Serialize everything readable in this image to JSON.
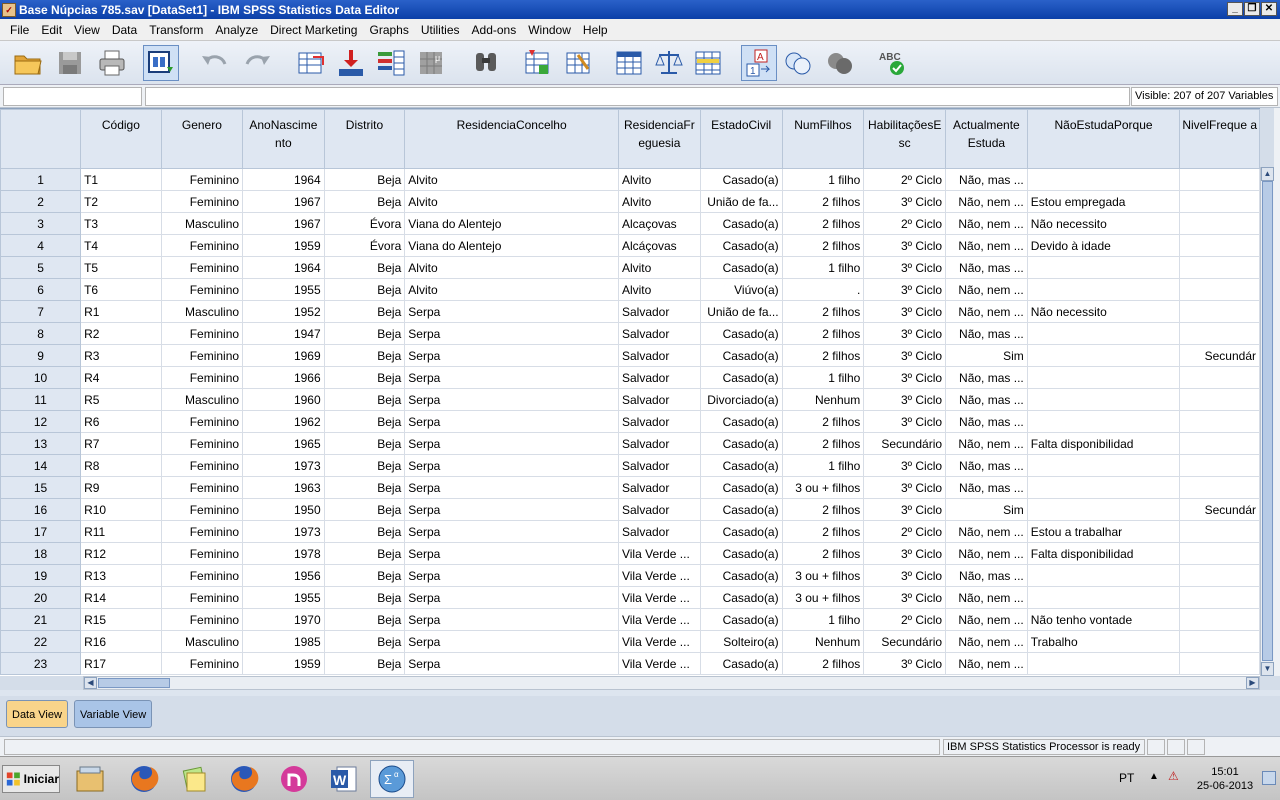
{
  "window": {
    "title": "Base Núpcias 785.sav [DataSet1] - IBM SPSS Statistics Data Editor"
  },
  "menu": [
    "File",
    "Edit",
    "View",
    "Data",
    "Transform",
    "Analyze",
    "Direct Marketing",
    "Graphs",
    "Utilities",
    "Add-ons",
    "Window",
    "Help"
  ],
  "editbar": {
    "cell_ref": "",
    "cell_value": "",
    "visible": "Visible: 207 of 207 Variables"
  },
  "grid": {
    "columns": [
      {
        "label": "Código",
        "align": "l"
      },
      {
        "label": "Genero",
        "align": "r"
      },
      {
        "label": "AnoNascime nto",
        "align": "r"
      },
      {
        "label": "Distrito",
        "align": "r"
      },
      {
        "label": "ResidenciaConcelho",
        "align": "l"
      },
      {
        "label": "ResidenciaFr eguesia",
        "align": "l"
      },
      {
        "label": "EstadoCivil",
        "align": "r"
      },
      {
        "label": "NumFilhos",
        "align": "r"
      },
      {
        "label": "HabilitaçõesE sc",
        "align": "r"
      },
      {
        "label": "Actualmente Estuda",
        "align": "r"
      },
      {
        "label": "NãoEstudaPorque",
        "align": "l"
      },
      {
        "label": "NivelFreque a",
        "align": "r"
      }
    ],
    "rows": [
      {
        "n": "1",
        "cells": [
          "T1",
          "Feminino",
          "1964",
          "Beja",
          "Alvito",
          "Alvito",
          "Casado(a)",
          "1 filho",
          "2º Ciclo",
          "Não, mas ...",
          "",
          ""
        ]
      },
      {
        "n": "2",
        "cells": [
          "T2",
          "Feminino",
          "1967",
          "Beja",
          "Alvito",
          "Alvito",
          "União de fa...",
          "2 filhos",
          "3º Ciclo",
          "Não, nem ...",
          "Estou empregada",
          ""
        ]
      },
      {
        "n": "3",
        "cells": [
          "T3",
          "Masculino",
          "1967",
          "Évora",
          "Viana do Alentejo",
          "Alcaçovas",
          "Casado(a)",
          "2 filhos",
          "2º Ciclo",
          "Não, nem ...",
          "Não necessito",
          ""
        ]
      },
      {
        "n": "4",
        "cells": [
          "T4",
          "Feminino",
          "1959",
          "Évora",
          "Viana do Alentejo",
          "Alcáçovas",
          "Casado(a)",
          "2 filhos",
          "3º Ciclo",
          "Não, nem ...",
          "Devido à idade",
          ""
        ]
      },
      {
        "n": "5",
        "cells": [
          "T5",
          "Feminino",
          "1964",
          "Beja",
          "Alvito",
          "Alvito",
          "Casado(a)",
          "1 filho",
          "3º Ciclo",
          "Não, mas ...",
          "",
          ""
        ]
      },
      {
        "n": "6",
        "cells": [
          "T6",
          "Feminino",
          "1955",
          "Beja",
          "Alvito",
          "Alvito",
          "Viúvo(a)",
          ".",
          "3º Ciclo",
          "Não, nem ...",
          "",
          ""
        ]
      },
      {
        "n": "7",
        "cells": [
          "R1",
          "Masculino",
          "1952",
          "Beja",
          "Serpa",
          "Salvador",
          "União de fa...",
          "2 filhos",
          "3º Ciclo",
          "Não, nem ...",
          "Não necessito",
          ""
        ]
      },
      {
        "n": "8",
        "cells": [
          "R2",
          "Feminino",
          "1947",
          "Beja",
          "Serpa",
          "Salvador",
          "Casado(a)",
          "2 filhos",
          "3º Ciclo",
          "Não, mas ...",
          "",
          ""
        ]
      },
      {
        "n": "9",
        "cells": [
          "R3",
          "Feminino",
          "1969",
          "Beja",
          "Serpa",
          "Salvador",
          "Casado(a)",
          "2 filhos",
          "3º Ciclo",
          "Sim",
          "",
          "Secundár"
        ]
      },
      {
        "n": "10",
        "cells": [
          "R4",
          "Feminino",
          "1966",
          "Beja",
          "Serpa",
          "Salvador",
          "Casado(a)",
          "1 filho",
          "3º Ciclo",
          "Não, mas ...",
          "",
          ""
        ]
      },
      {
        "n": "11",
        "cells": [
          "R5",
          "Masculino",
          "1960",
          "Beja",
          "Serpa",
          "Salvador",
          "Divorciado(a)",
          "Nenhum",
          "3º Ciclo",
          "Não, mas ...",
          "",
          ""
        ]
      },
      {
        "n": "12",
        "cells": [
          "R6",
          "Feminino",
          "1962",
          "Beja",
          "Serpa",
          "Salvador",
          "Casado(a)",
          "2 filhos",
          "3º Ciclo",
          "Não, mas ...",
          "",
          ""
        ]
      },
      {
        "n": "13",
        "cells": [
          "R7",
          "Feminino",
          "1965",
          "Beja",
          "Serpa",
          "Salvador",
          "Casado(a)",
          "2 filhos",
          "Secundário",
          "Não, nem ...",
          "Falta disponibilidad",
          ""
        ]
      },
      {
        "n": "14",
        "cells": [
          "R8",
          "Feminino",
          "1973",
          "Beja",
          "Serpa",
          "Salvador",
          "Casado(a)",
          "1 filho",
          "3º Ciclo",
          "Não, mas ...",
          "",
          ""
        ]
      },
      {
        "n": "15",
        "cells": [
          "R9",
          "Feminino",
          "1963",
          "Beja",
          "Serpa",
          "Salvador",
          "Casado(a)",
          "3 ou + filhos",
          "3º Ciclo",
          "Não, mas ...",
          "",
          ""
        ]
      },
      {
        "n": "16",
        "cells": [
          "R10",
          "Feminino",
          "1950",
          "Beja",
          "Serpa",
          "Salvador",
          "Casado(a)",
          "2 filhos",
          "3º Ciclo",
          "Sim",
          "",
          "Secundár"
        ]
      },
      {
        "n": "17",
        "cells": [
          "R11",
          "Feminino",
          "1973",
          "Beja",
          "Serpa",
          "Salvador",
          "Casado(a)",
          "2 filhos",
          "2º Ciclo",
          "Não, nem ...",
          "Estou a trabalhar",
          ""
        ]
      },
      {
        "n": "18",
        "cells": [
          "R12",
          "Feminino",
          "1978",
          "Beja",
          "Serpa",
          "Vila Verde ...",
          "Casado(a)",
          "2 filhos",
          "3º Ciclo",
          "Não, nem ...",
          "Falta disponibilidad",
          ""
        ]
      },
      {
        "n": "19",
        "cells": [
          "R13",
          "Feminino",
          "1956",
          "Beja",
          "Serpa",
          "Vila Verde ...",
          "Casado(a)",
          "3 ou + filhos",
          "3º Ciclo",
          "Não, mas ...",
          "",
          ""
        ]
      },
      {
        "n": "20",
        "cells": [
          "R14",
          "Feminino",
          "1955",
          "Beja",
          "Serpa",
          "Vila Verde ...",
          "Casado(a)",
          "3 ou + filhos",
          "3º Ciclo",
          "Não, nem ...",
          "",
          ""
        ]
      },
      {
        "n": "21",
        "cells": [
          "R15",
          "Feminino",
          "1970",
          "Beja",
          "Serpa",
          "Vila Verde ...",
          "Casado(a)",
          "1 filho",
          "2º Ciclo",
          "Não, nem ...",
          "Não tenho vontade",
          ""
        ]
      },
      {
        "n": "22",
        "cells": [
          "R16",
          "Masculino",
          "1985",
          "Beja",
          "Serpa",
          "Vila Verde ...",
          "Solteiro(a)",
          "Nenhum",
          "Secundário",
          "Não, nem ...",
          "Trabalho",
          ""
        ]
      },
      {
        "n": "23",
        "cells": [
          "R17",
          "Feminino",
          "1959",
          "Beja",
          "Serpa",
          "Vila Verde ...",
          "Casado(a)",
          "2 filhos",
          "3º Ciclo",
          "Não, nem ...",
          "",
          ""
        ]
      }
    ]
  },
  "tabs": {
    "data_view": "Data View",
    "variable_view": "Variable View"
  },
  "status": {
    "processor": "IBM SPSS Statistics Processor is ready"
  },
  "taskbar": {
    "start_label": "Iniciar",
    "lang": "PT",
    "time": "15:01",
    "date": "25-06-2013"
  },
  "colors": {
    "titlebar": "#0b3fa8",
    "header_bg": "#dfe7f2",
    "active_tab": "#f9d48a",
    "inactive_tab": "#a9c4e7"
  }
}
